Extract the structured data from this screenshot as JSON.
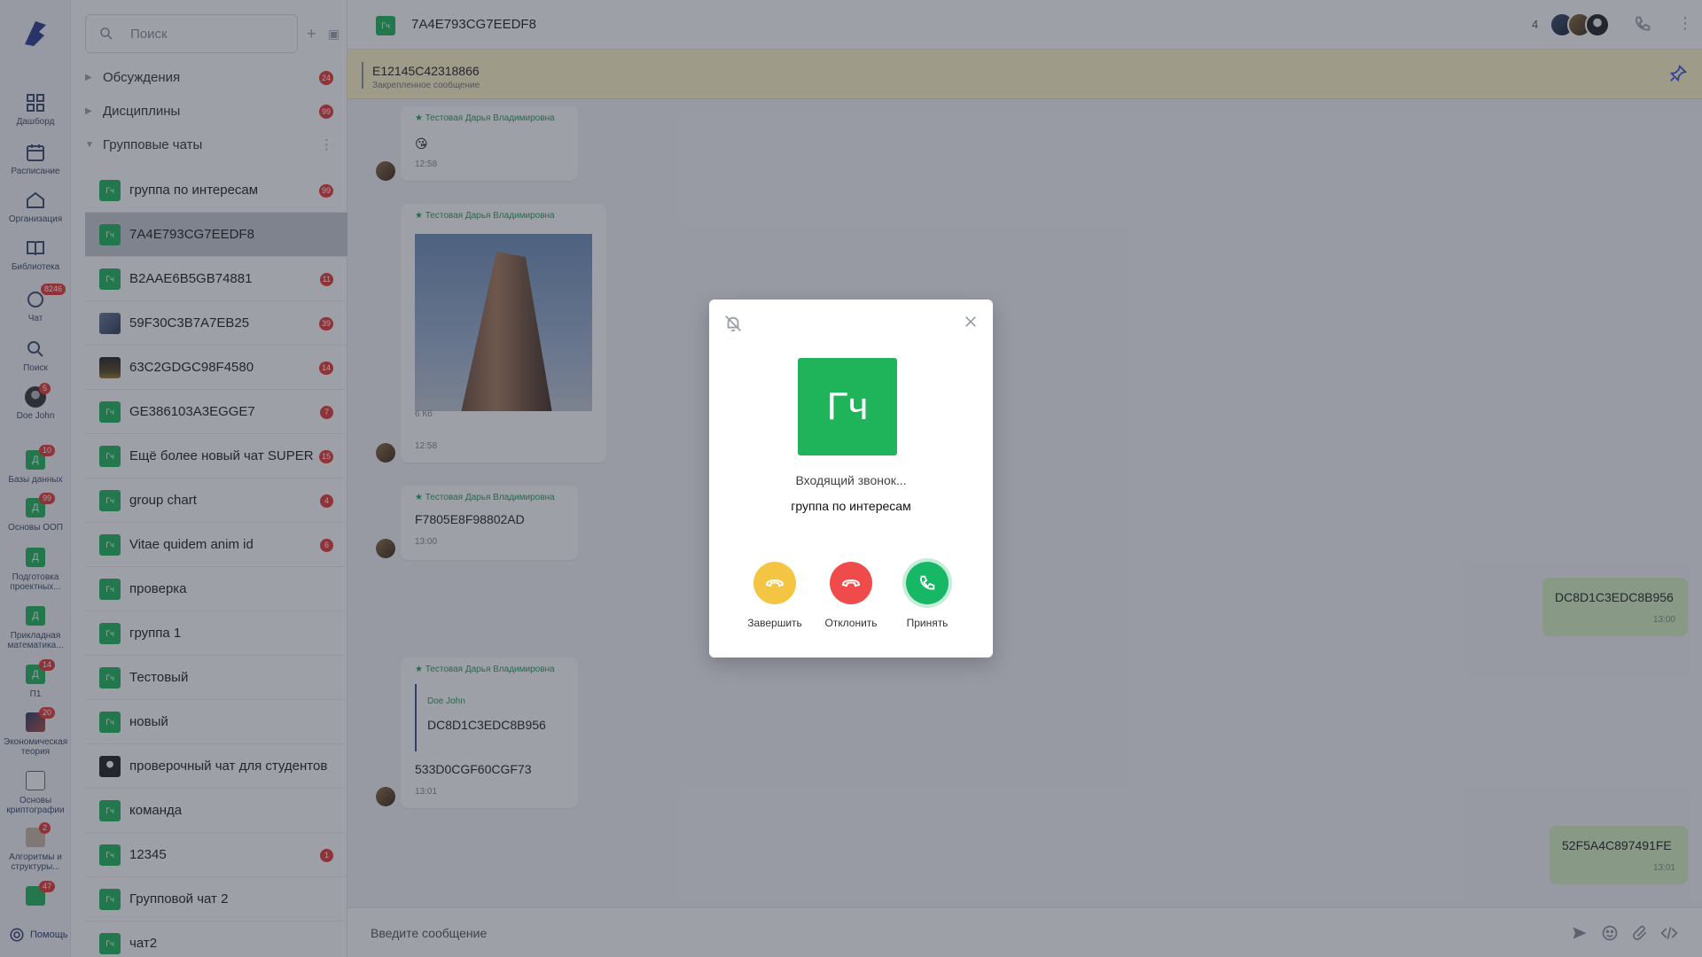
{
  "rail": {
    "items": [
      {
        "label": "Дашборд"
      },
      {
        "label": "Расписание"
      },
      {
        "label": "Организация"
      },
      {
        "label": "Библиотека"
      },
      {
        "label": "Чат",
        "badge": "8246"
      },
      {
        "label": "Поиск"
      },
      {
        "label": "Doe John",
        "badge": "5"
      }
    ],
    "courses": [
      {
        "letter": "Д",
        "label": "Базы данных",
        "badge": "10"
      },
      {
        "letter": "Д",
        "label": "Основы ООП",
        "badge": "99"
      },
      {
        "letter": "Д",
        "label": "Подготовка проектных...",
        "badge": ""
      },
      {
        "letter": "Д",
        "label": "Прикладная математика...",
        "badge": ""
      },
      {
        "letter": "Д",
        "label": "П1",
        "badge": "14"
      },
      {
        "letter": "",
        "label": "Экономическая теория",
        "badge": "20"
      },
      {
        "letter": "",
        "label": "Основы криптографии",
        "badge": ""
      },
      {
        "letter": "",
        "label": "Алгоритмы и структуры...",
        "badge": "2"
      },
      {
        "letter": "",
        "label": "",
        "badge": "47"
      }
    ],
    "help": "Помощь"
  },
  "list": {
    "search_placeholder": "Поиск",
    "sections": [
      {
        "label": "Обсуждения",
        "count": "24"
      },
      {
        "label": "Дисциплины",
        "count": "99"
      },
      {
        "label": "Групповые чаты",
        "count": ""
      }
    ],
    "chats": [
      {
        "av": "Гч",
        "name": "группа по интересам",
        "count": "99"
      },
      {
        "av": "Гч",
        "name": "7A4E793CG7EEDF8",
        "count": ""
      },
      {
        "av": "Гч",
        "name": "B2AAE6B5GB74881",
        "count": "11"
      },
      {
        "av": "",
        "name": "59F30C3B7A7EB25",
        "count": "39"
      },
      {
        "av": "",
        "name": "63C2GDGC98F4580",
        "count": "14"
      },
      {
        "av": "Гч",
        "name": "GE386103A3EGGE7",
        "count": "7"
      },
      {
        "av": "Гч",
        "name": "Ещё более новый чат SUPER",
        "count": "15"
      },
      {
        "av": "Гч",
        "name": "group chart",
        "count": "4"
      },
      {
        "av": "Гч",
        "name": "Vitae quidem anim id",
        "count": "6"
      },
      {
        "av": "Гч",
        "name": "проверка",
        "count": ""
      },
      {
        "av": "Гч",
        "name": "группа 1",
        "count": ""
      },
      {
        "av": "Гч",
        "name": "Тестовый",
        "count": ""
      },
      {
        "av": "Гч",
        "name": "новый",
        "count": ""
      },
      {
        "av": "",
        "name": "проверочный чат для студентов",
        "count": ""
      },
      {
        "av": "Гч",
        "name": "команда",
        "count": ""
      },
      {
        "av": "Гч",
        "name": "12345",
        "count": "1"
      },
      {
        "av": "Гч",
        "name": "Групповой чат 2",
        "count": ""
      },
      {
        "av": "Гч",
        "name": "чат2",
        "count": ""
      }
    ]
  },
  "header": {
    "avatar": "Гч",
    "title": "7A4E793CG7EEDF8",
    "members": "4"
  },
  "pinned": {
    "title": "E12145C42318866",
    "subtitle": "Закрепленное сообщение"
  },
  "messages": {
    "author": "Тестовая Дарья Владимировна",
    "m1": {
      "emoji": "😘",
      "time": "12:58"
    },
    "m2": {
      "size": "6 Кб",
      "time": "12:58"
    },
    "m3": {
      "text": "F7805E8F98802AD",
      "time": "13:00"
    },
    "mine1": {
      "text": "DC8D1C3EDC8B956",
      "time": "13:00"
    },
    "m4": {
      "quote_author": "Doe John",
      "quote_text": "DC8D1C3EDC8B956",
      "text": "533D0CGF60CGF73",
      "time": "13:01"
    },
    "mine2": {
      "text": "52F5A4C897491FE",
      "time": "13:01"
    }
  },
  "input": {
    "placeholder": "Введите сообщение"
  },
  "call": {
    "avatar": "Гч",
    "status": "Входящий звонок...",
    "name": "группа по интересам",
    "end_label": "Завершить",
    "decline_label": "Отклонить",
    "accept_label": "Принять"
  },
  "colors": {
    "accent_green": "#20b45a",
    "end": "#f3c542",
    "decline": "#ef4b4b",
    "accept": "#16b866",
    "badge": "#e53935"
  }
}
